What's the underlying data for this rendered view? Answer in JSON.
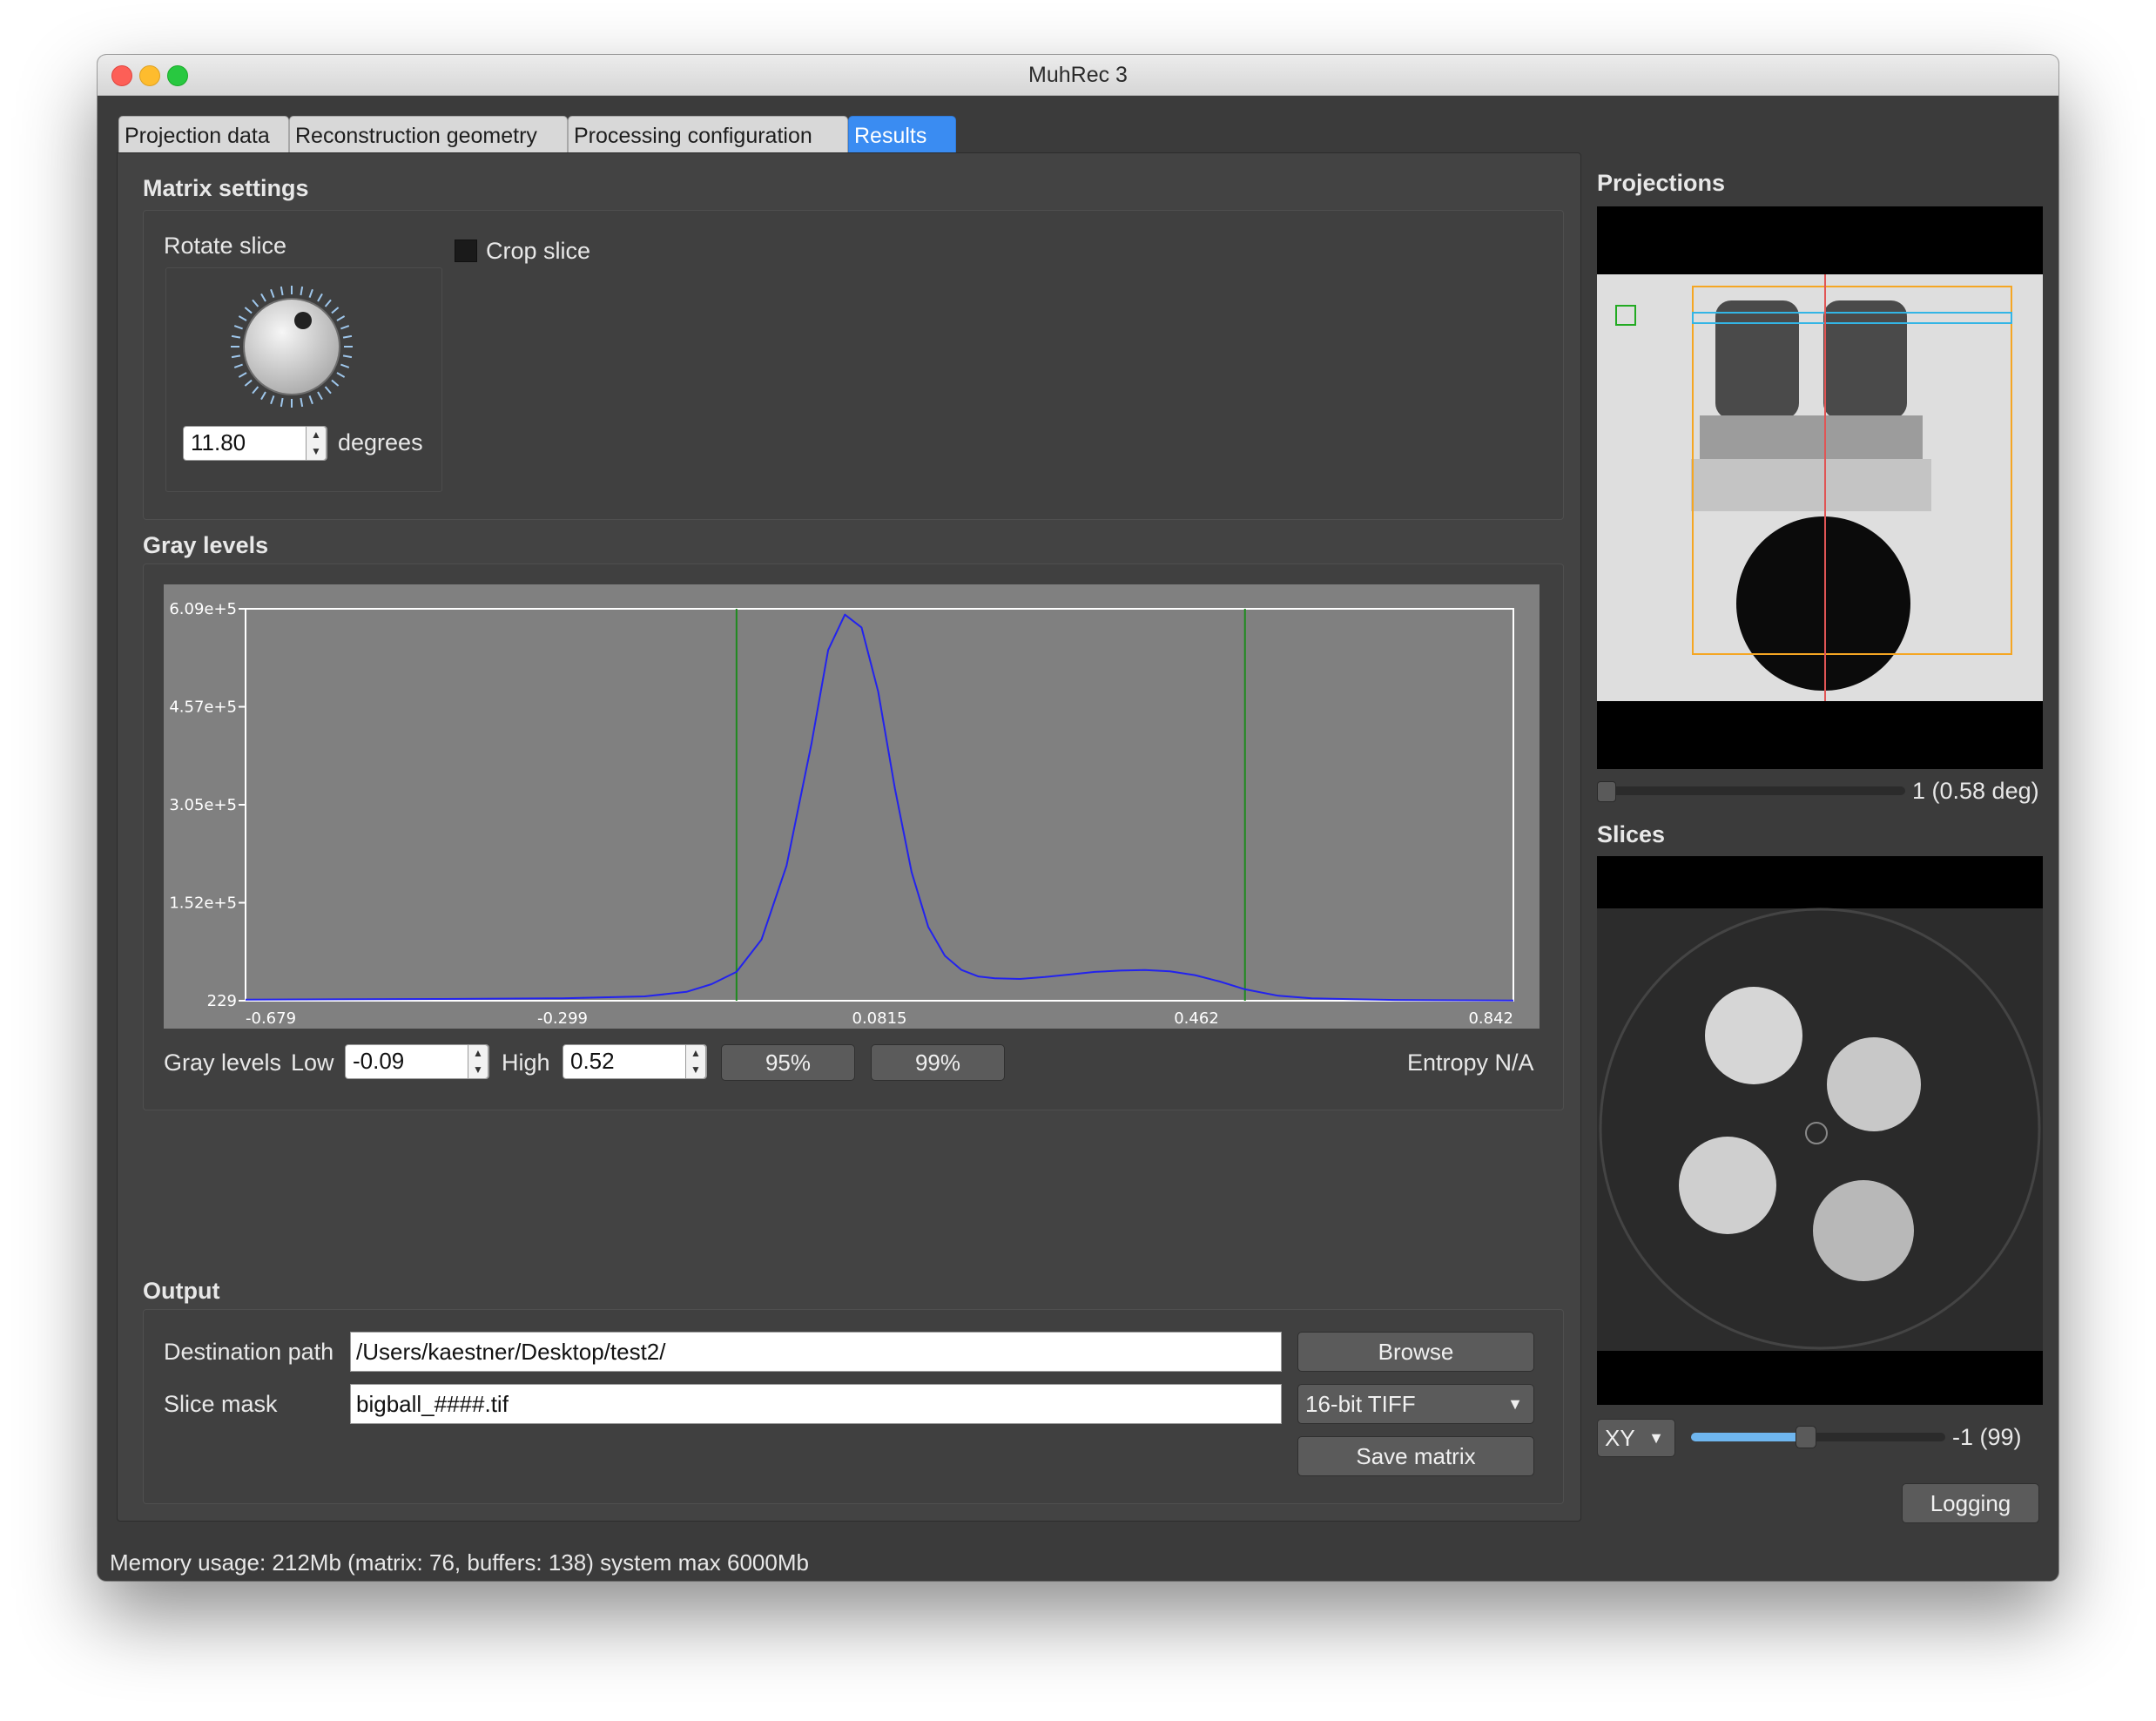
{
  "window": {
    "title": "MuhRec 3"
  },
  "tabs": [
    {
      "label": "Projection data",
      "active": false
    },
    {
      "label": "Reconstruction geometry",
      "active": false
    },
    {
      "label": "Processing configuration",
      "active": false
    },
    {
      "label": "Results",
      "active": true
    }
  ],
  "matrix_settings": {
    "heading": "Matrix settings",
    "rotate_label": "Rotate slice",
    "rotate_value": "11.80",
    "degrees_label": "degrees",
    "crop_label": "Crop slice",
    "crop_checked": false
  },
  "gray_levels": {
    "heading": "Gray levels",
    "row_label": "Gray levels",
    "low_label": "Low",
    "low_value": "-0.09",
    "high_label": "High",
    "high_value": "0.52",
    "btn_95": "95%",
    "btn_99": "99%",
    "entropy": "Entropy N/A"
  },
  "chart_data": {
    "type": "line",
    "title": "",
    "xlabel": "",
    "ylabel": "",
    "x_ticks": [
      "-0.679",
      "-0.299",
      "0.0815",
      "0.462",
      "0.842"
    ],
    "y_ticks": [
      "229",
      "1.52e+5",
      "3.05e+5",
      "4.57e+5",
      "6.09e+5"
    ],
    "xlim": [
      -0.679,
      0.842
    ],
    "ylim": [
      229,
      609000
    ],
    "grid": false,
    "markers": [
      -0.09,
      0.52
    ],
    "marker_color": "#1e8a1e",
    "series": [
      {
        "color": "#2222ee",
        "x": [
          -0.679,
          -0.45,
          -0.299,
          -0.2,
          -0.15,
          -0.12,
          -0.09,
          -0.06,
          -0.03,
          0.0,
          0.02,
          0.04,
          0.06,
          0.08,
          0.1,
          0.12,
          0.14,
          0.16,
          0.18,
          0.2,
          0.22,
          0.25,
          0.28,
          0.31,
          0.34,
          0.37,
          0.4,
          0.43,
          0.46,
          0.49,
          0.52,
          0.56,
          0.6,
          0.65,
          0.7,
          0.75,
          0.842
        ],
        "y": [
          2000,
          3000,
          4000,
          7000,
          14000,
          26000,
          45000,
          95000,
          210000,
          400000,
          545000,
          600000,
          580000,
          480000,
          330000,
          200000,
          115000,
          70000,
          48000,
          38000,
          35000,
          34000,
          37000,
          41000,
          45000,
          47000,
          48000,
          46000,
          40000,
          30000,
          18000,
          8000,
          4000,
          2500,
          1500,
          1000,
          500
        ]
      }
    ]
  },
  "output": {
    "heading": "Output",
    "dest_label": "Destination path",
    "dest_value": "/Users/kaestner/Desktop/test2/",
    "mask_label": "Slice mask",
    "mask_value": "bigball_####.tif",
    "browse_label": "Browse",
    "format_value": "16-bit TIFF",
    "save_label": "Save matrix"
  },
  "status": {
    "memory": "Memory usage: 212Mb (matrix: 76, buffers: 138) system max 6000Mb"
  },
  "projections": {
    "heading": "Projections",
    "slider_label": "1 (0.58 deg)",
    "slider_value": 0
  },
  "slices": {
    "heading": "Slices",
    "plane_value": "XY",
    "slider_label": "-1 (99)",
    "slider_value": 0.45
  },
  "logging_label": "Logging",
  "colors": {
    "accent": "#3a8cf2",
    "background": "#3b3b3b",
    "roi_orange": "#f5a623",
    "roi_blue": "#33b5e5"
  }
}
